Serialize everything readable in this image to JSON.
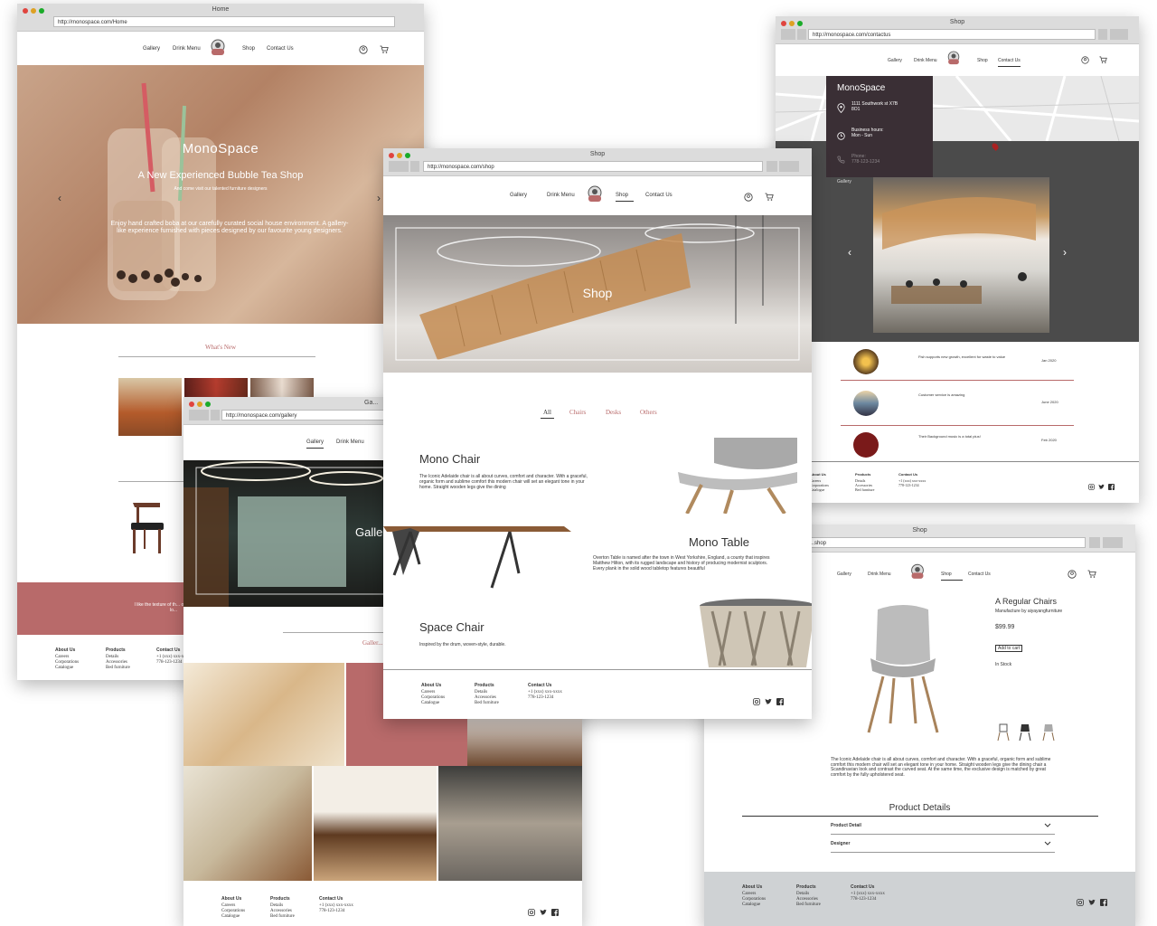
{
  "home": {
    "window_title": "Home",
    "url": "http://monospace.com/Home",
    "nav": [
      "Gallery",
      "Drink Menu",
      "Shop",
      "Contact Us"
    ],
    "hero_title": "MonoSpace",
    "hero_subtitle": "A New Experienced Bubble Tea Shop",
    "hero_tagline": "And come visit our talented furniture designers",
    "hero_text": "Enjoy hand crafted boba at our carefully curated social house environment. A gallery-like experience furnished with pieces designed by our favourite young designers.",
    "whats_new": "What's New",
    "testimonial": "I like the texture of th... of their furniture lo...",
    "footer": {
      "about": {
        "title": "About Us",
        "lines": [
          "Careers",
          "Corporations",
          "Catalogue"
        ]
      },
      "products": {
        "title": "Products",
        "lines": [
          "Details",
          "Accessories",
          "Bed furniture"
        ]
      },
      "contact": {
        "title": "Contact Us",
        "lines": [
          "+1 (xxx) xxx-xxxx",
          "778-123-1234"
        ]
      }
    }
  },
  "gallery": {
    "window_title": "Ga...",
    "url": "http://monospace.com/gallery",
    "nav": [
      "Gallery",
      "Drink Menu"
    ],
    "hero_title": "Galle...",
    "section_title": "Galler...",
    "footer": {
      "about": {
        "title": "About Us",
        "lines": [
          "Careers",
          "Corporations",
          "Catalogue"
        ]
      },
      "products": {
        "title": "Products",
        "lines": [
          "Details",
          "Accessories",
          "Bed furniture"
        ]
      },
      "contact": {
        "title": "Contact Us",
        "lines": [
          "+1 (xxx) xxx-xxxx",
          "778-123-1234"
        ]
      }
    }
  },
  "shop": {
    "window_title": "Shop",
    "url": "http://monospace.com/shop",
    "nav": [
      "Gallery",
      "Drink Menu",
      "Shop",
      "Contact Us"
    ],
    "hero_title": "Shop",
    "filters": [
      "All",
      "Chairs",
      "Desks",
      "Others"
    ],
    "products": [
      {
        "name": "Mono Chair",
        "desc": "The Iconic Adelaide chair is all about curves, comfort and character. With a graceful, organic form and sublime comfort this modern chair will set an elegant tone in your home. Straight wooden legs give the dining"
      },
      {
        "name": "Mono Table",
        "desc": "Overton Table is named after the town in West Yorkshire, England, a county that inspires Matthew Hilton, with its rugged landscape and history of producing modernist sculptors. Every plank in the solid wood tabletop features beautiful"
      },
      {
        "name": "Space Chair",
        "desc": "Inspired by the drum, woven-style, durable."
      }
    ],
    "footer": {
      "about": {
        "title": "About Us",
        "lines": [
          "Careers",
          "Corporations",
          "Catalogue"
        ]
      },
      "products": {
        "title": "Products",
        "lines": [
          "Details",
          "Accessories",
          "Bed furniture"
        ]
      },
      "contact": {
        "title": "Contact Us",
        "lines": [
          "+1 (xxx) xxx-xxxx",
          "778-123-1234"
        ]
      }
    }
  },
  "contact": {
    "window_title": "Shop",
    "url": "http://monospace.com/contactus",
    "nav": [
      "Gallery",
      "Drink Menu",
      "Shop",
      "Contact Us"
    ],
    "card_title": "MonoSpace",
    "address": "1111 Southwork st X7B 8O1",
    "hours_label": "Business hours:",
    "hours": "Mon - Sun",
    "phone_label": "Phone:",
    "phone": "778-123-1234",
    "gallery_label": "Gallery",
    "reviews": [
      {
        "text": "Fish supports new growth, excellent for waste to value",
        "date": "Jan 2020"
      },
      {
        "text": "Customer service is amazing",
        "date": "June 2020"
      },
      {
        "text": "Their Background music is a total plus!",
        "date": "Feb 2020"
      }
    ],
    "footer": {
      "about": {
        "title": "About Us",
        "lines": [
          "Careers",
          "Corporations",
          "Catalogue"
        ]
      },
      "products": {
        "title": "Products",
        "lines": [
          "Details",
          "Accessories",
          "Bed furniture"
        ]
      },
      "contact": {
        "title": "Contact Us",
        "lines": [
          "+1 (xxx) xxx-xxxx",
          "778-123-1234"
        ]
      }
    }
  },
  "product": {
    "window_title": "Shop",
    "url": "...shop",
    "nav": [
      "Gallery",
      "Drink Menu",
      "Shop",
      "Contact Us"
    ],
    "title": "A Regular Chairs",
    "manufacturer": "Manufacture by aiyayangfurniture",
    "price": "$99.99",
    "add_to_cart": "Add to cart",
    "stock": "In Stock",
    "description": "The Iconic Adelaide chair is all about curves, comfort and character. With a graceful, organic form and sublime comfort this modern chair will set an elegant tone in your home. Straight wooden legs give the dining chair a Scandinavian look and contrast the curved seat. At the same time, the exclusive design is matched by great comfort by the fully upholstered seat.",
    "details_heading": "Product Details",
    "accordion": [
      "Product Detail",
      "Designer"
    ],
    "footer": {
      "about": {
        "title": "About Us",
        "lines": [
          "Careers",
          "Corporations",
          "Catalogue"
        ]
      },
      "products": {
        "title": "Products",
        "lines": [
          "Details",
          "Accessories",
          "Bed furniture"
        ]
      },
      "contact": {
        "title": "Contact Us",
        "lines": [
          "+1 (xxx) xxx-xxxx",
          "778-123-1234"
        ]
      }
    }
  },
  "colors": {
    "accent": "#b86a6a",
    "footer_gray": "#cfd2d4",
    "dark_card": "#3a2f35"
  }
}
